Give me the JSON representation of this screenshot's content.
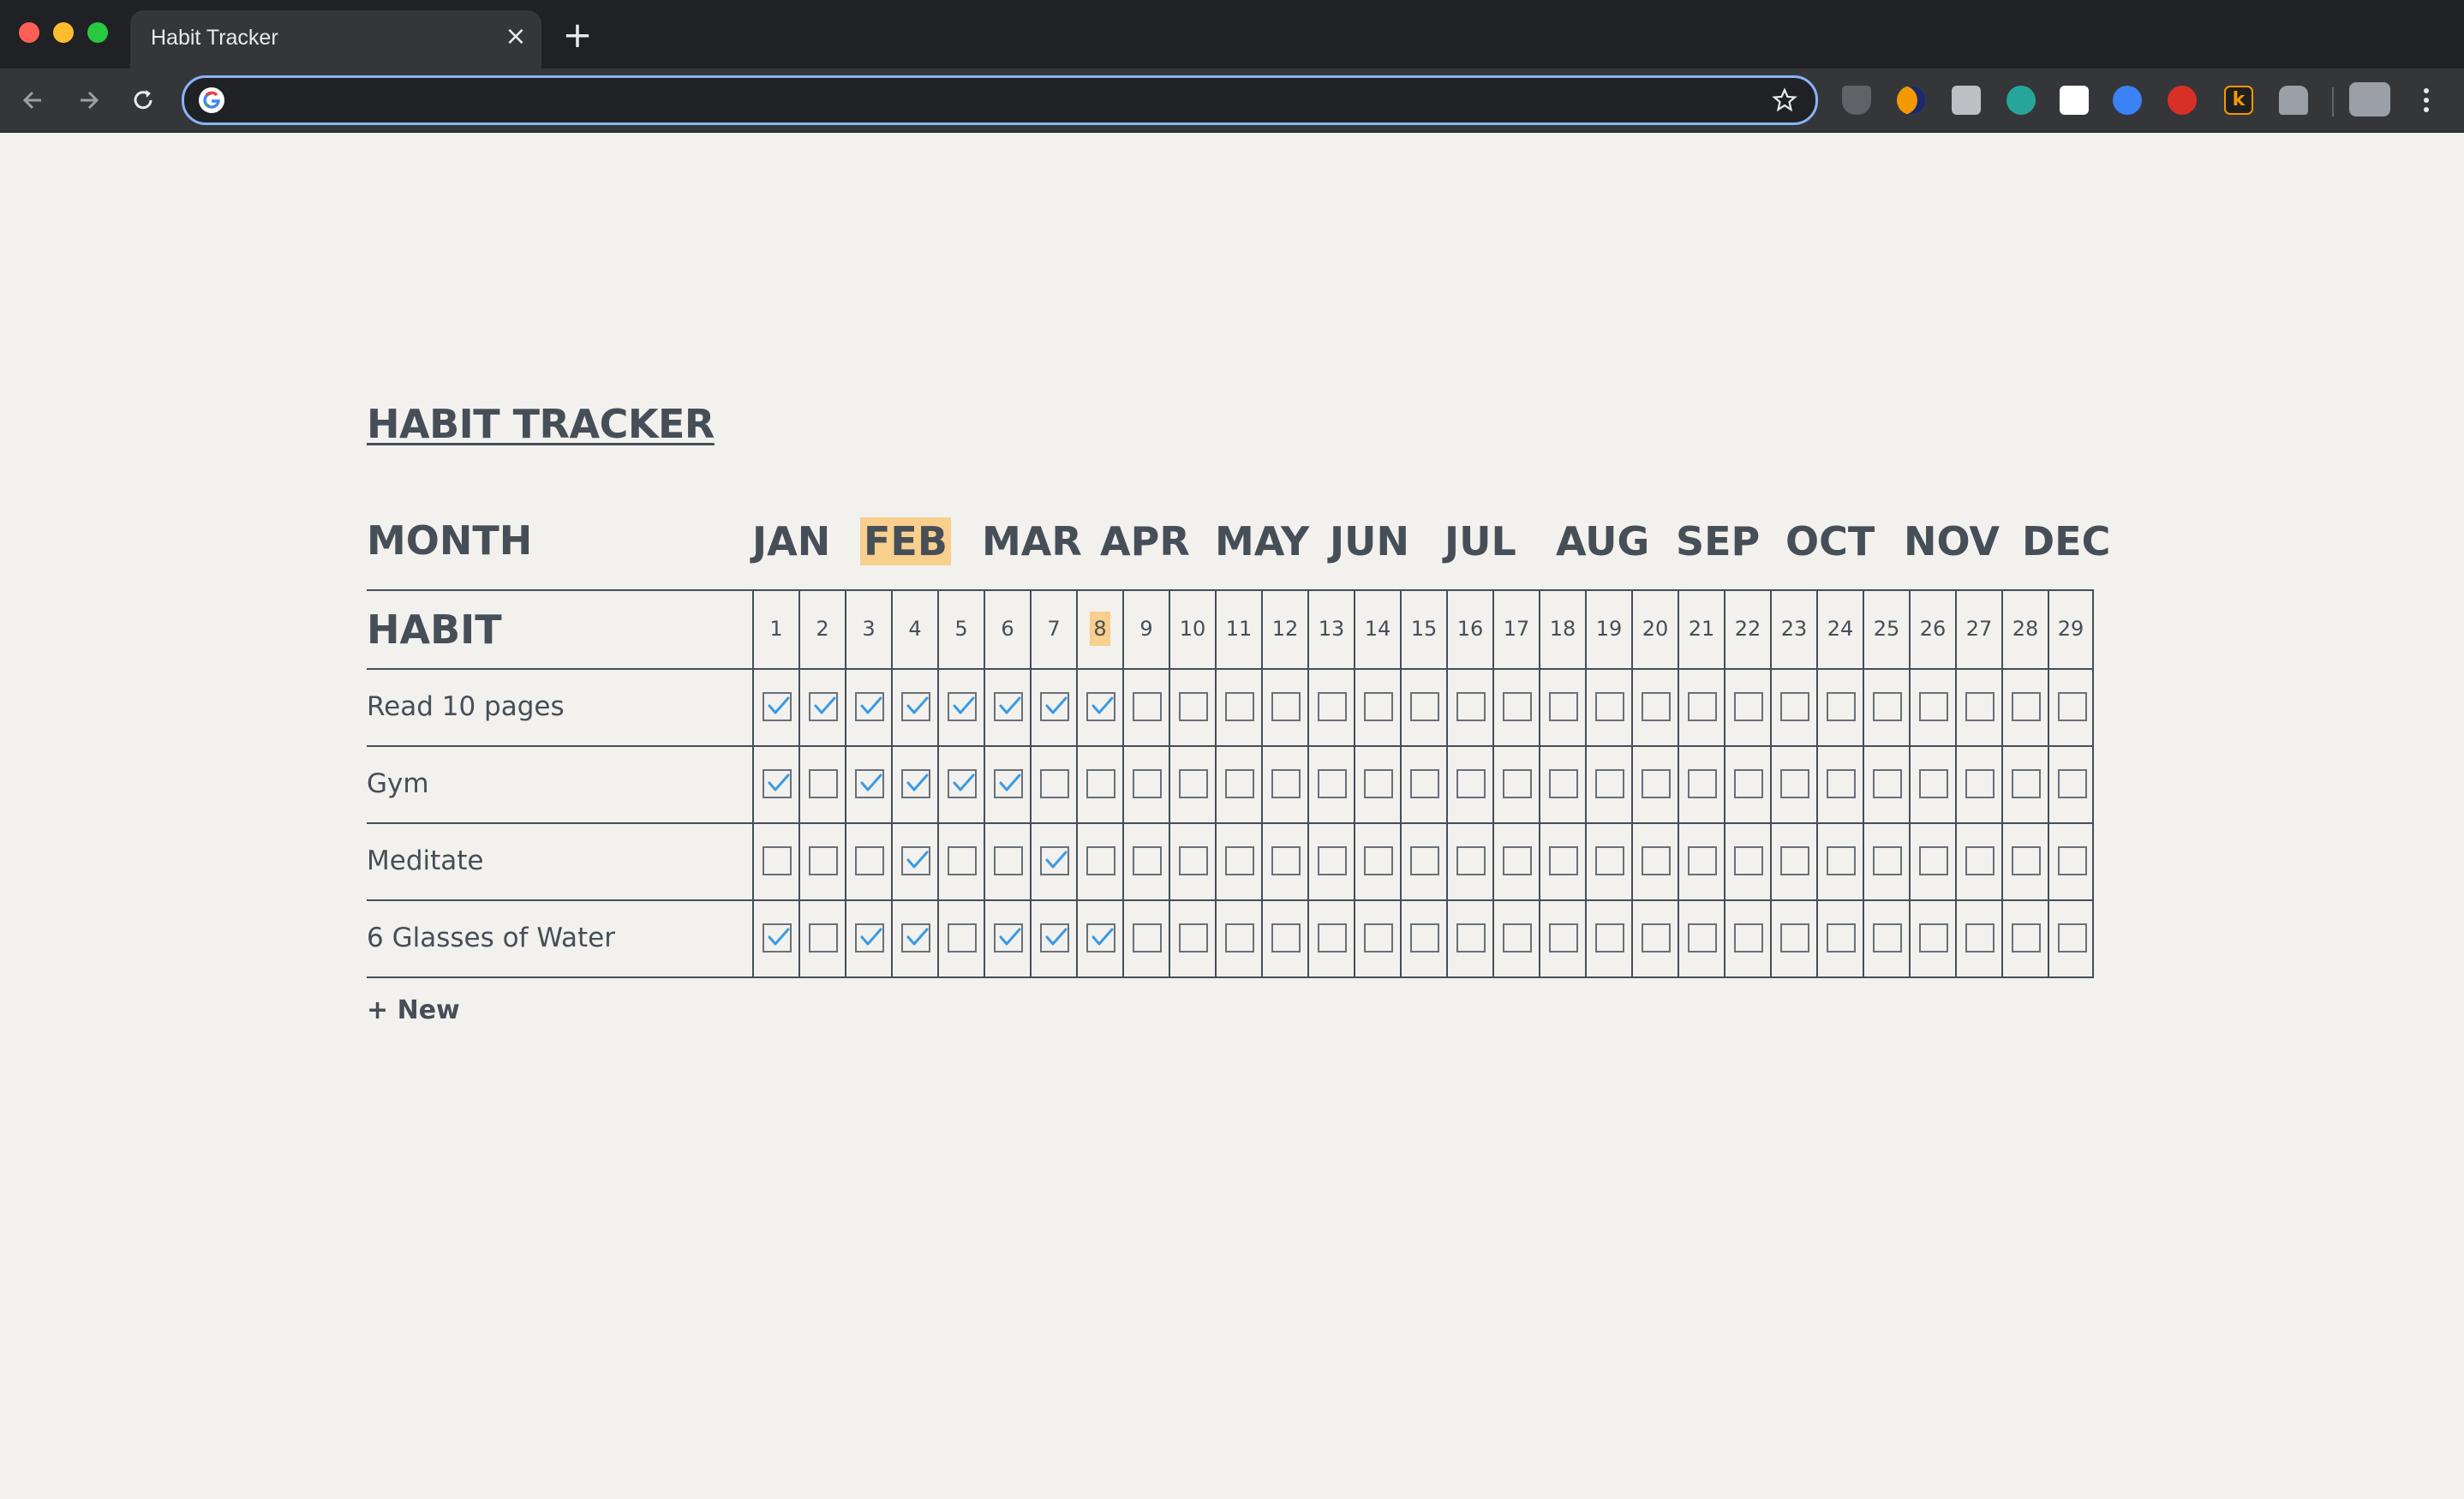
{
  "browser": {
    "tab_title": "Habit Tracker",
    "tab_close": "×",
    "new_tab": "+",
    "address_value": "",
    "extensions": [
      "ublock-icon",
      "crescent-icon",
      "camera-icon",
      "teal-circle-icon",
      "notion-icon",
      "checkmark-circle-icon",
      "seo-icon",
      "k-icon",
      "ghost-icon"
    ],
    "ext_k_letter": "k"
  },
  "page": {
    "title": "HABIT TRACKER",
    "month_label": "MONTH",
    "months": [
      "JAN",
      "FEB",
      "MAR",
      "APR",
      "MAY",
      "JUN",
      "JUL",
      "AUG",
      "SEP",
      "OCT",
      "NOV",
      "DEC"
    ],
    "selected_month": "FEB",
    "habit_label": "HABIT",
    "days": [
      "1",
      "2",
      "3",
      "4",
      "5",
      "6",
      "7",
      "8",
      "9",
      "10",
      "11",
      "12",
      "13",
      "14",
      "15",
      "16",
      "17",
      "18",
      "19",
      "20",
      "21",
      "22",
      "23",
      "24",
      "25",
      "26",
      "27",
      "28",
      "29"
    ],
    "today": "8",
    "habits": [
      {
        "name": "Read 10 pages",
        "checked": [
          1,
          2,
          3,
          4,
          5,
          6,
          7,
          8
        ]
      },
      {
        "name": "Gym",
        "checked": [
          1,
          3,
          4,
          5,
          6
        ]
      },
      {
        "name": "Meditate",
        "checked": [
          4,
          7
        ]
      },
      {
        "name": "6 Glasses of Water",
        "checked": [
          1,
          3,
          4,
          6,
          7,
          8
        ]
      }
    ],
    "new_button": "+ New"
  },
  "colors": {
    "text": "#464e57",
    "check": "#3b9ae1",
    "highlight": "#f8cf8c",
    "background": "#f2f1ee"
  }
}
